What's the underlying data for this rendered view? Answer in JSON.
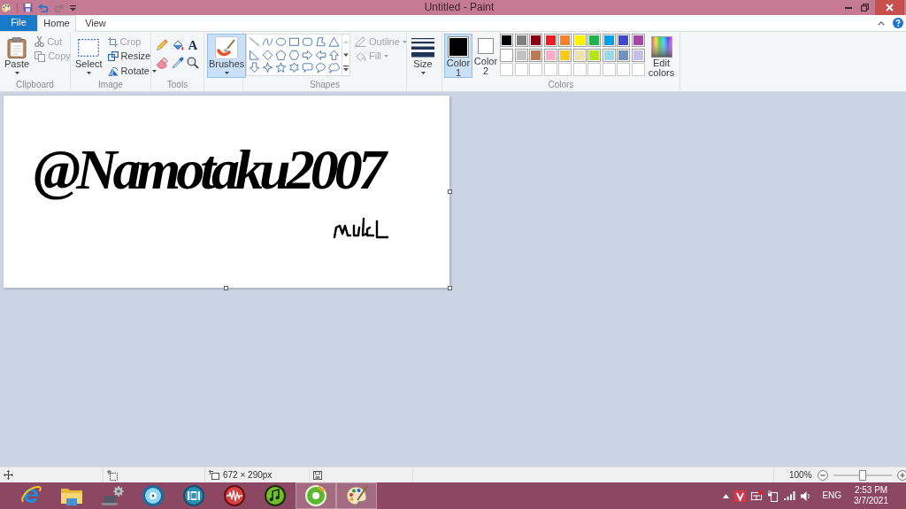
{
  "title_bar": {
    "title": "Untitled - Paint",
    "quick_access": [
      {
        "kind": "save",
        "disabled": false
      },
      {
        "kind": "undo",
        "disabled": false
      },
      {
        "kind": "redo",
        "disabled": true
      },
      {
        "kind": "customize",
        "disabled": false
      }
    ]
  },
  "ribbon_tabs": [
    {
      "label": "File",
      "kind": "application",
      "selected": false
    },
    {
      "label": "Home",
      "kind": "tab",
      "selected": true
    },
    {
      "label": "View",
      "kind": "tab",
      "selected": false
    }
  ],
  "ribbon": {
    "clipboard": {
      "label": "Clipboard",
      "paste": "Paste",
      "commands": [
        {
          "label": "Cut",
          "kind": "cut",
          "disabled": true,
          "dropdown": false
        },
        {
          "label": "Copy",
          "kind": "copy",
          "disabled": true,
          "dropdown": false
        }
      ]
    },
    "image": {
      "label": "Image",
      "select": "Select",
      "commands": [
        {
          "label": "Crop",
          "kind": "crop",
          "disabled": true,
          "dropdown": false
        },
        {
          "label": "Resize",
          "kind": "resize",
          "disabled": false,
          "dropdown": false
        },
        {
          "label": "Rotate",
          "kind": "rotate",
          "disabled": false,
          "dropdown": true
        }
      ]
    },
    "tools": {
      "label": "Tools",
      "items": [
        {
          "kind": "pencil",
          "selected": false
        },
        {
          "kind": "fill",
          "selected": false
        },
        {
          "kind": "text",
          "glyph": "A",
          "selected": false
        },
        {
          "kind": "eraser",
          "selected": false
        },
        {
          "kind": "color_picker",
          "selected": false
        },
        {
          "kind": "magnifier",
          "selected": false
        }
      ]
    },
    "brushes": {
      "label": "Brushes",
      "selected": true
    },
    "shapes": {
      "label": "Shapes",
      "gallery": [
        {
          "kind": "line",
          "selected": false
        },
        {
          "kind": "curve",
          "selected": false
        },
        {
          "kind": "oval",
          "selected": false
        },
        {
          "kind": "rectangle",
          "selected": false
        },
        {
          "kind": "rounded_rectangle",
          "selected": false
        },
        {
          "kind": "polygon",
          "selected": false
        },
        {
          "kind": "triangle",
          "selected": false
        },
        {
          "kind": "right_triangle",
          "selected": false
        },
        {
          "kind": "diamond",
          "selected": false
        },
        {
          "kind": "pentagon",
          "selected": false
        },
        {
          "kind": "hexagon",
          "selected": false
        },
        {
          "kind": "right_arrow",
          "selected": false
        },
        {
          "kind": "left_arrow",
          "selected": false
        },
        {
          "kind": "up_arrow",
          "selected": false
        },
        {
          "kind": "down_arrow",
          "selected": false
        },
        {
          "kind": "four_point_star",
          "selected": false
        },
        {
          "kind": "five_point_star",
          "selected": false
        },
        {
          "kind": "six_point_star",
          "selected": false
        },
        {
          "kind": "rounded_callout",
          "selected": false
        },
        {
          "kind": "oval_callout",
          "selected": false
        },
        {
          "kind": "cloud_callout",
          "selected": false
        }
      ],
      "options": [
        {
          "label": "Outline",
          "kind": "outline",
          "disabled": true,
          "dropdown": true
        },
        {
          "label": "Fill",
          "kind": "fill",
          "disabled": true,
          "dropdown": true
        }
      ]
    },
    "size": {
      "label": "Size"
    },
    "colors": {
      "label": "Colors",
      "current": [
        {
          "label": "Color 1",
          "color": "#000000",
          "selected": true
        },
        {
          "label": "Color 2",
          "color": "#ffffff",
          "selected": false
        }
      ],
      "palette": [
        {
          "kind": "swatch",
          "color": "#000000"
        },
        {
          "kind": "swatch",
          "color": "#7f7f7f"
        },
        {
          "kind": "swatch",
          "color": "#880015"
        },
        {
          "kind": "swatch",
          "color": "#ed1c24"
        },
        {
          "kind": "swatch",
          "color": "#ff7f27"
        },
        {
          "kind": "swatch",
          "color": "#fff200"
        },
        {
          "kind": "swatch",
          "color": "#22b14c"
        },
        {
          "kind": "swatch",
          "color": "#00a2e8"
        },
        {
          "kind": "swatch",
          "color": "#3f48cc"
        },
        {
          "kind": "swatch",
          "color": "#a349a4"
        },
        {
          "kind": "swatch",
          "color": "#ffffff"
        },
        {
          "kind": "swatch",
          "color": "#c3c3c3"
        },
        {
          "kind": "swatch",
          "color": "#b97a57"
        },
        {
          "kind": "swatch",
          "color": "#ffaec9"
        },
        {
          "kind": "swatch",
          "color": "#ffc90e"
        },
        {
          "kind": "swatch",
          "color": "#efe4b0"
        },
        {
          "kind": "swatch",
          "color": "#b5e61d"
        },
        {
          "kind": "swatch",
          "color": "#99d9ea"
        },
        {
          "kind": "swatch",
          "color": "#7092be"
        },
        {
          "kind": "swatch",
          "color": "#c8bfe7"
        },
        {
          "kind": "empty"
        },
        {
          "kind": "empty"
        },
        {
          "kind": "empty"
        },
        {
          "kind": "empty"
        },
        {
          "kind": "empty"
        },
        {
          "kind": "empty"
        },
        {
          "kind": "empty"
        },
        {
          "kind": "empty"
        },
        {
          "kind": "empty"
        },
        {
          "kind": "empty"
        }
      ],
      "edit": "Edit colors"
    }
  },
  "canvas": {
    "text": "@Namotaku2007"
  },
  "status_bar": {
    "canvas_size": "672 × 290px",
    "zoom": {
      "reading": "100%",
      "level": 0.5
    }
  },
  "taskbar": {
    "apps": [
      {
        "kind": "browser",
        "open": false
      },
      {
        "kind": "file_explorer",
        "open": false
      },
      {
        "kind": "system_settings",
        "open": false
      },
      {
        "kind": "disc_player",
        "open": false
      },
      {
        "kind": "video_player",
        "open": false
      },
      {
        "kind": "audio_editor",
        "open": false
      },
      {
        "kind": "music_player",
        "open": false
      },
      {
        "kind": "ring_app",
        "open": true
      },
      {
        "kind": "paint",
        "open": true
      }
    ],
    "tray": {
      "icons": [
        {
          "kind": "show_hidden"
        },
        {
          "kind": "antivirus"
        },
        {
          "kind": "network_error"
        },
        {
          "kind": "power"
        },
        {
          "kind": "signal"
        },
        {
          "kind": "volume"
        }
      ],
      "language": "ENG",
      "time": "2:53 PM",
      "date": "3/7/2021"
    }
  }
}
